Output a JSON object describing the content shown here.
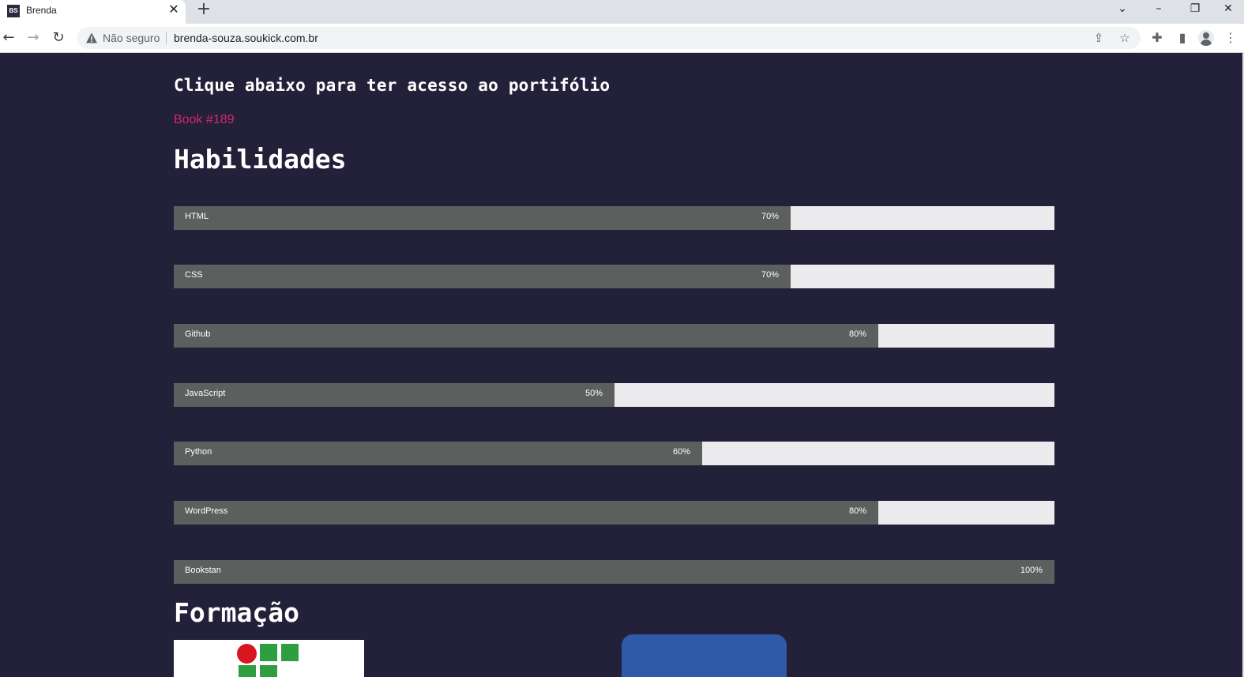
{
  "browser": {
    "tab_title": "Brenda",
    "favicon_text": "BS",
    "new_tab_symbol": "+",
    "security_label": "Não seguro",
    "url": "brenda-souza.soukick.com.br"
  },
  "content": {
    "cta_text": "Clique abaixo para ter acesso ao portifólio",
    "book_link": "Book #189",
    "skills_title": "Habilidades",
    "skills": [
      {
        "name": "HTML",
        "label": "70%",
        "level": 0.7
      },
      {
        "name": "CSS",
        "label": "70%",
        "level": 0.7
      },
      {
        "name": "Github",
        "label": "80%",
        "level": 0.8
      },
      {
        "name": "JavaScript",
        "label": "50%",
        "level": 0.5
      },
      {
        "name": "Python",
        "label": "60%",
        "level": 0.6
      },
      {
        "name": "WordPress",
        "label": "80%",
        "level": 0.8
      },
      {
        "name": "Bookstan",
        "label": "100%",
        "level": 1.0
      }
    ],
    "education_title": "Formação"
  },
  "colors": {
    "page_bg": "#23203a",
    "accent_link": "#d3276d",
    "bar_fill": "#5c5f5d",
    "bar_track": "#ebebee"
  },
  "icons": [
    "warning-icon",
    "share-icon",
    "star-icon",
    "puzzle-icon",
    "side-panel-icon",
    "profile-icon",
    "menu-icon"
  ]
}
